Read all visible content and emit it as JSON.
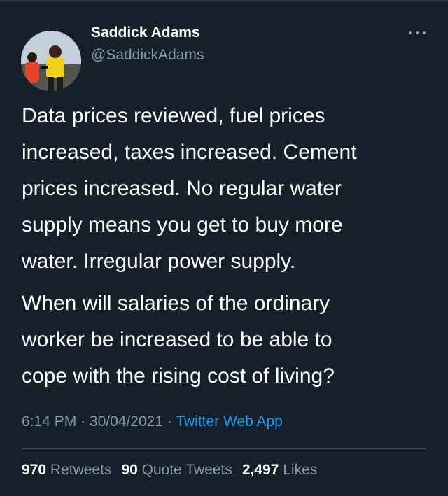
{
  "tweet": {
    "author": {
      "display_name": "Saddick Adams",
      "handle": "@SaddickAdams"
    },
    "paragraphs": [
      "Data prices reviewed, fuel prices\nincreased, taxes increased. Cement\nprices increased. No regular water\nsupply means you get to buy more\nwater. Irregular power supply.",
      "When will salaries of the ordinary\nworker be increased to be able to\ncope with the rising cost of living?"
    ],
    "time": "6:14 PM",
    "separator": "·",
    "date": "30/04/2021",
    "source": "Twitter Web App",
    "stats": {
      "retweets_count": "970",
      "retweets_label": "Retweets",
      "quotes_count": "90",
      "quotes_label": "Quote Tweets",
      "likes_count": "2,497",
      "likes_label": "Likes"
    }
  },
  "colors": {
    "background": "#15202b",
    "text_primary": "#ffffff",
    "text_secondary": "#8899a6",
    "link": "#1d9bf0",
    "divider": "#38444d"
  },
  "icons": {
    "more": "more-horizontal-icon"
  }
}
